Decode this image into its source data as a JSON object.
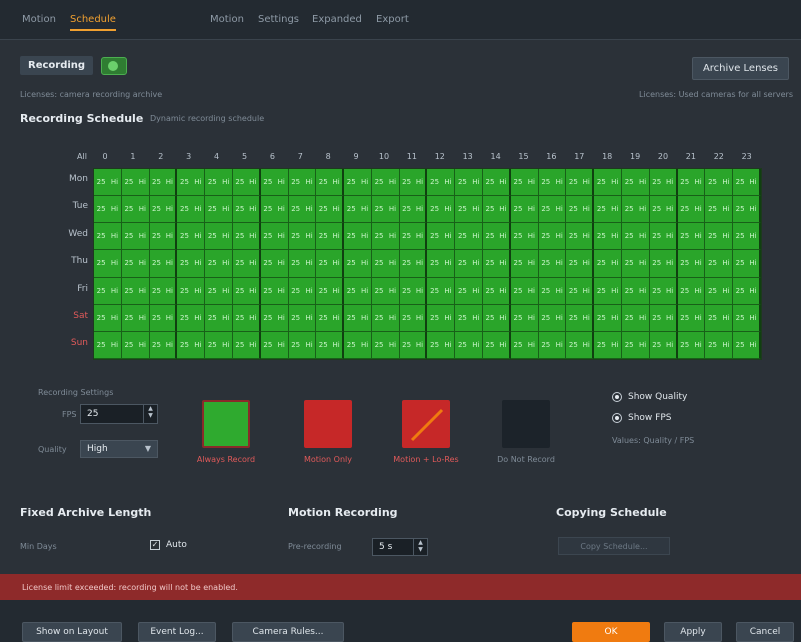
{
  "tabs": [
    {
      "label": "Motion"
    },
    {
      "label": "Schedule"
    },
    {
      "label": "Motion"
    },
    {
      "label": "Settings"
    },
    {
      "label": "Expanded"
    },
    {
      "label": "Export"
    }
  ],
  "recording": {
    "label": "Recording",
    "enabled": true
  },
  "archive_button": "Archive Lenses",
  "subnote": "Licenses: camera recording archive",
  "subnote_right": "Licenses: Used cameras for all servers",
  "schedule": {
    "title": "Recording Schedule",
    "subtitle": "Dynamic recording schedule"
  },
  "hours": [
    "All",
    "0",
    "1",
    "2",
    "3",
    "4",
    "5",
    "6",
    "7",
    "8",
    "9",
    "10",
    "11",
    "12",
    "13",
    "14",
    "15",
    "16",
    "17",
    "18",
    "19",
    "20",
    "21",
    "22",
    "23"
  ],
  "days": [
    "Mon",
    "Tue",
    "Wed",
    "Thu",
    "Fri",
    "Sat",
    "Sun"
  ],
  "cell_value": "25",
  "cell_unit": "Hi",
  "controls": {
    "title": "Recording Settings",
    "fps_label": "FPS",
    "fps_value": "25",
    "quality_label": "Quality",
    "quality_value": "High"
  },
  "modes": [
    {
      "label": "Always Record",
      "color": "#2faa2f",
      "border": "#8a2a2a"
    },
    {
      "label": "Motion Only",
      "color": "#c62828",
      "border": "#c62828"
    },
    {
      "label": "Motion + Lo-Res",
      "color": "#c62828",
      "border": "#c62828"
    },
    {
      "label": "Do Not Record",
      "color": "#1c232a",
      "border": "#1c232a"
    }
  ],
  "display": {
    "option1": "Show Quality",
    "option2": "Show FPS",
    "note": "Values: Quality / FPS"
  },
  "fixed_archive": {
    "title": "Fixed Archive Length",
    "field_label": "Min Days",
    "checkbox_label": "Auto",
    "checked": true
  },
  "motion_recording": {
    "title": "Motion Recording",
    "field_label": "Pre-recording",
    "value": "5 s"
  },
  "copying_schedule": {
    "title": "Copying Schedule",
    "button": "Copy Schedule..."
  },
  "warning": "License limit exceeded: recording will not be enabled.",
  "footer": {
    "btn1": "Show on Layout",
    "btn2": "Event Log...",
    "btn3": "Camera Rules...",
    "ok": "OK",
    "apply": "Apply",
    "cancel": "Cancel"
  }
}
